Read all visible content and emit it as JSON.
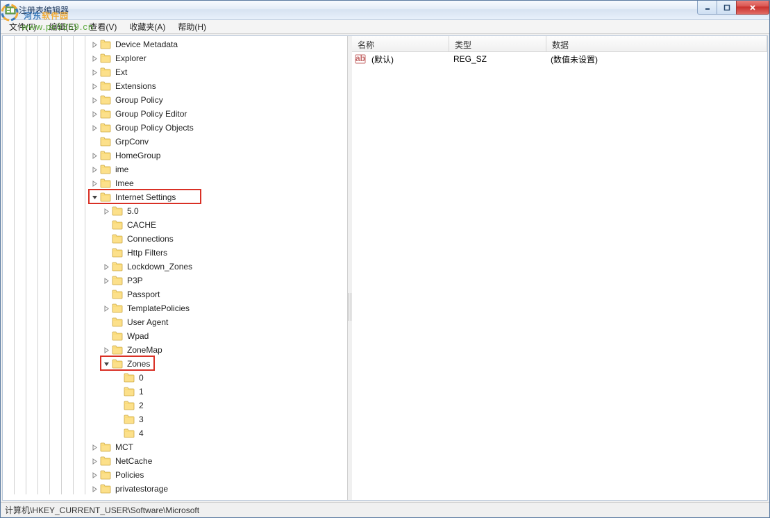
{
  "window": {
    "title": "注册表编辑器"
  },
  "menu": {
    "file": "文件(F)",
    "edit": "编辑(E)",
    "view": "查看(V)",
    "favorites": "收藏夹(A)",
    "help": "帮助(H)"
  },
  "tree": {
    "items": [
      {
        "indent": 7,
        "toggle": "right",
        "label": "Device Metadata"
      },
      {
        "indent": 7,
        "toggle": "right",
        "label": "Explorer"
      },
      {
        "indent": 7,
        "toggle": "right",
        "label": "Ext"
      },
      {
        "indent": 7,
        "toggle": "right",
        "label": "Extensions"
      },
      {
        "indent": 7,
        "toggle": "right",
        "label": "Group Policy"
      },
      {
        "indent": 7,
        "toggle": "right",
        "label": "Group Policy Editor"
      },
      {
        "indent": 7,
        "toggle": "right",
        "label": "Group Policy Objects"
      },
      {
        "indent": 7,
        "toggle": "none",
        "label": "GrpConv"
      },
      {
        "indent": 7,
        "toggle": "right",
        "label": "HomeGroup"
      },
      {
        "indent": 7,
        "toggle": "right",
        "label": "ime"
      },
      {
        "indent": 7,
        "toggle": "right",
        "label": "Imee"
      },
      {
        "indent": 7,
        "toggle": "down",
        "label": "Internet Settings",
        "highlight": true
      },
      {
        "indent": 8,
        "toggle": "right",
        "label": "5.0"
      },
      {
        "indent": 8,
        "toggle": "none",
        "label": "CACHE"
      },
      {
        "indent": 8,
        "toggle": "none",
        "label": "Connections"
      },
      {
        "indent": 8,
        "toggle": "none",
        "label": "Http Filters"
      },
      {
        "indent": 8,
        "toggle": "right",
        "label": "Lockdown_Zones"
      },
      {
        "indent": 8,
        "toggle": "right",
        "label": "P3P"
      },
      {
        "indent": 8,
        "toggle": "none",
        "label": "Passport"
      },
      {
        "indent": 8,
        "toggle": "right",
        "label": "TemplatePolicies"
      },
      {
        "indent": 8,
        "toggle": "none",
        "label": "User Agent"
      },
      {
        "indent": 8,
        "toggle": "none",
        "label": "Wpad"
      },
      {
        "indent": 8,
        "toggle": "right",
        "label": "ZoneMap"
      },
      {
        "indent": 8,
        "toggle": "down",
        "label": "Zones",
        "highlight": true
      },
      {
        "indent": 9,
        "toggle": "none",
        "label": "0"
      },
      {
        "indent": 9,
        "toggle": "none",
        "label": "1"
      },
      {
        "indent": 9,
        "toggle": "none",
        "label": "2"
      },
      {
        "indent": 9,
        "toggle": "none",
        "label": "3"
      },
      {
        "indent": 9,
        "toggle": "none",
        "label": "4"
      },
      {
        "indent": 7,
        "toggle": "right",
        "label": "MCT"
      },
      {
        "indent": 7,
        "toggle": "right",
        "label": "NetCache"
      },
      {
        "indent": 7,
        "toggle": "right",
        "label": "Policies"
      },
      {
        "indent": 7,
        "toggle": "right",
        "label": "privatestorage"
      }
    ]
  },
  "list": {
    "columns": {
      "name": "名称",
      "type": "类型",
      "data": "数据"
    },
    "rows": [
      {
        "name": "(默认)",
        "type": "REG_SZ",
        "data": "(数值未设置)"
      }
    ]
  },
  "statusbar": {
    "path": "计算机\\HKEY_CURRENT_USER\\Software\\Microsoft"
  },
  "watermark": {
    "brand_a": "河东",
    "brand_b": "软件园",
    "url": "www.pc0359.cn"
  }
}
